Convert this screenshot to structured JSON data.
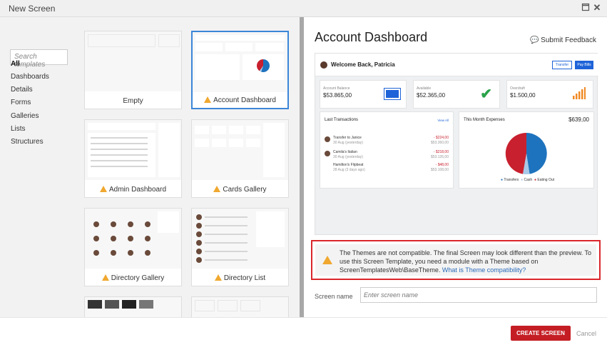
{
  "window": {
    "title": "New Screen"
  },
  "left": {
    "search_placeholder": "Search templates",
    "categories": [
      "All",
      "Dashboards",
      "Details",
      "Forms",
      "Galleries",
      "Lists",
      "Structures"
    ],
    "templates": [
      {
        "label": "Empty",
        "warning": false
      },
      {
        "label": "Account Dashboard",
        "warning": true
      },
      {
        "label": "Admin Dashboard",
        "warning": true
      },
      {
        "label": "Cards Gallery",
        "warning": true
      },
      {
        "label": "Directory Gallery",
        "warning": true
      },
      {
        "label": "Directory List",
        "warning": true
      }
    ]
  },
  "preview": {
    "title": "Account Dashboard",
    "feedback": "Submit Feedback",
    "welcome": "Welcome Back, Patricia",
    "transfer": "Transfer",
    "pay": "Pay Bills",
    "kpis": [
      {
        "label": "Account Balance",
        "value": "$53.865,00"
      },
      {
        "label": "Available",
        "value": "$52.365,00"
      },
      {
        "label": "Overdraft",
        "value": "$1.500,00"
      }
    ],
    "transactions_title": "Last Transactions",
    "view_all": "View All",
    "transactions": [
      {
        "name": "Transfer to Janice",
        "date": "30 Aug (yesterday)",
        "amount": "- $224,00",
        "balance": "$53.360,00"
      },
      {
        "name": "Camila's Italian",
        "date": "30 Aug (yesterday)",
        "amount": "- $218,00",
        "balance": "$53.126,00"
      },
      {
        "name": "Hamilton's Flipbeat",
        "date": "28 Aug (3 days ago)",
        "amount": "- $48,00",
        "balance": "$53.108,00"
      }
    ],
    "expenses_title": "This Month Expenses",
    "expenses_total": "$639,00",
    "legend": [
      "Transfers",
      "Cash",
      "Eating Out"
    ],
    "colors": {
      "transfers": "#1e73be",
      "cash": "#a8c8e8",
      "eating_out": "#c8202e"
    }
  },
  "warning": {
    "text": "The Themes are not compatible. The final Screen may look different than the preview. To use this Screen Template, you need a module with a Theme based on ScreenTemplatesWeb\\BaseTheme.",
    "link": "What is Theme compatibility?"
  },
  "screen_name": {
    "label": "Screen name",
    "placeholder": "Enter screen name"
  },
  "footer": {
    "create": "CREATE SCREEN",
    "cancel": "Cancel"
  }
}
